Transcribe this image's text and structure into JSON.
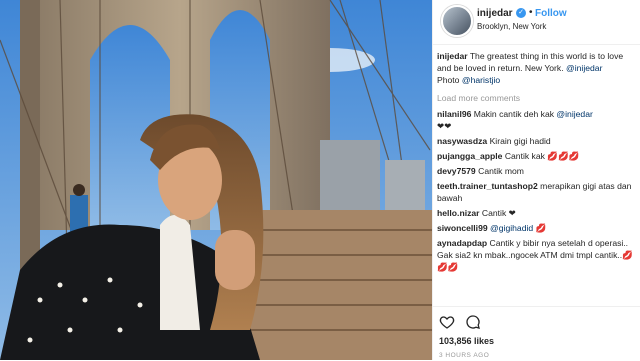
{
  "header": {
    "username": "inijedar",
    "verified_icon": "verified-check-icon",
    "separator": "•",
    "follow_label": "Follow",
    "location": "Brooklyn, New York"
  },
  "caption": {
    "username": "inijedar",
    "text": "The greatest thing in this world is to love and be loved in return. New York.",
    "mention": "@inijedar",
    "photo_credit_label": "Photo",
    "photo_credit_mention": "@haristjio"
  },
  "load_more_label": "Load more comments",
  "comments": [
    {
      "user": "nilanil96",
      "text": "Makin cantik deh kak",
      "mention": "@inijedar",
      "suffix": "❤❤"
    },
    {
      "user": "nasywasdza",
      "text": "Kirain gigi hadid"
    },
    {
      "user": "pujangga_apple",
      "text": "Cantik kak 💋💋💋"
    },
    {
      "user": "devy7579",
      "text": "Cantik mom"
    },
    {
      "user": "teeth.trainer_tuntashop2",
      "text": "merapikan gigi atas dan bawah"
    },
    {
      "user": "hello.nizar",
      "text": "Cantik ❤"
    },
    {
      "user": "siwoncelli99",
      "mention": "@gigihadid",
      "suffix": "💋"
    },
    {
      "user": "aynadapdap",
      "text": "Cantik y bibir nya setelah d operasi.. Gak sia2 kn mbak..ngocek ATM dmi tmpl cantik..💋💋💋"
    }
  ],
  "actions": {
    "like_icon": "heart-icon",
    "comment_icon": "comment-icon"
  },
  "likes": "103,856 likes",
  "timestamp": "3 HOURS AGO",
  "colors": {
    "link": "#3897f0",
    "mention": "#003569",
    "muted": "#999999"
  }
}
